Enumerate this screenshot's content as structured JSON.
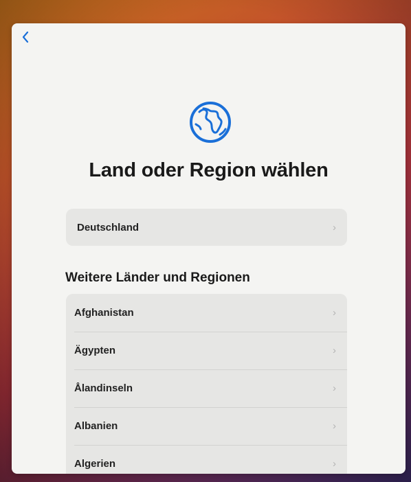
{
  "navigation": {
    "back_icon": "chevron-left-icon"
  },
  "header": {
    "icon": "globe-icon",
    "title": "Land oder Region wählen"
  },
  "current_region": {
    "label": "Deutschland"
  },
  "other_regions": {
    "title": "Weitere Länder und Regionen",
    "items": [
      {
        "label": "Afghanistan"
      },
      {
        "label": "Ägypten"
      },
      {
        "label": "Ålandinseln"
      },
      {
        "label": "Albanien"
      },
      {
        "label": "Algerien"
      }
    ]
  },
  "colors": {
    "accent": "#1a6fd8",
    "panel": "#f4f4f2",
    "row": "#e6e6e4"
  }
}
